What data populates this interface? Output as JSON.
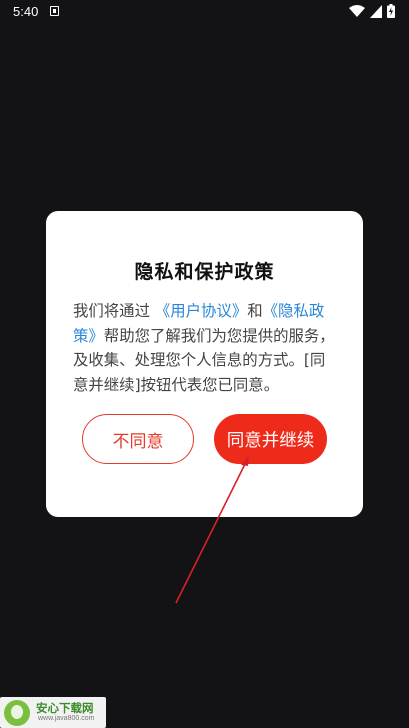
{
  "status_bar": {
    "time": "5:40",
    "icons": [
      "notification-icon",
      "wifi-icon",
      "cellular-signal-icon",
      "battery-charging-icon"
    ]
  },
  "dialog": {
    "title": "隐私和保护政策",
    "body": {
      "part1": "我们将通过",
      "user_agreement_link": "《用户协议》",
      "part2": "和",
      "privacy_policy_link": "《隐私政策》",
      "part3": "帮助您了解我们为您提供的服务，及收集、处理您个人信息的方式。[同意并继续]按钮代表您已同意。"
    },
    "disagree_label": "不同意",
    "agree_label": "同意并继续"
  },
  "colors": {
    "background": "#131215",
    "link": "#2a87d8",
    "accent_red": "#ee2a1b"
  },
  "watermark": {
    "title": "安心下载网",
    "url": "www.java800.com"
  }
}
